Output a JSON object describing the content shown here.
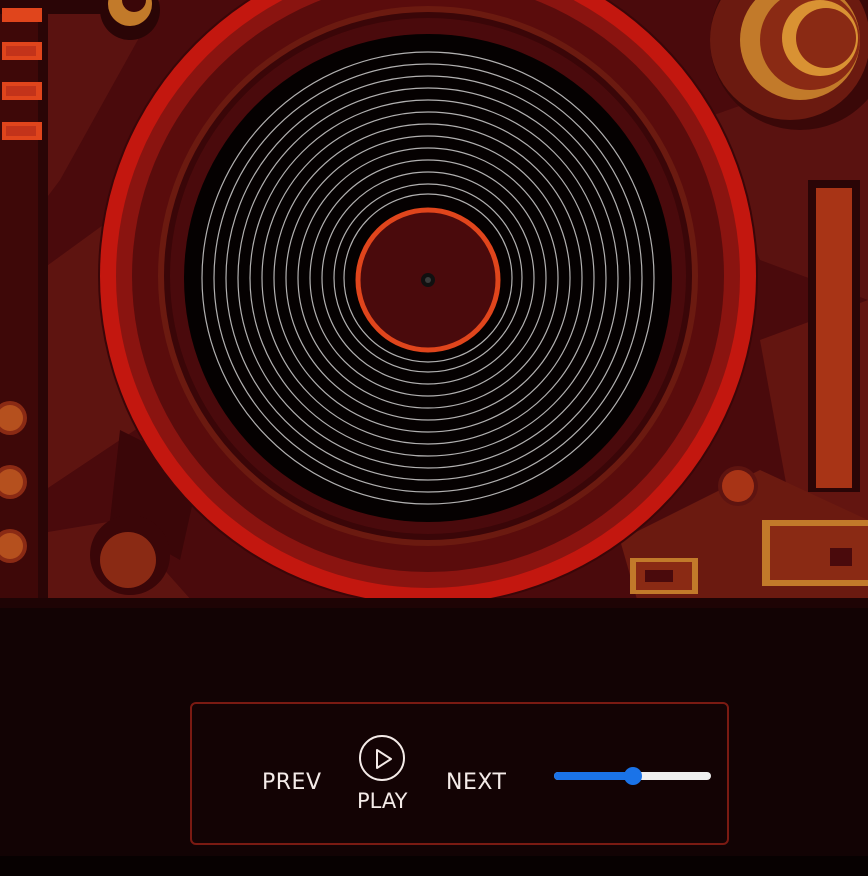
{
  "player": {
    "prev_label": "PREV",
    "play_label": "PLAY",
    "next_label": "NEXT",
    "volume_level": 0.5
  },
  "colors": {
    "accent": "#1a73e8",
    "background": "#120304",
    "panel_border": "#7a1a12",
    "record_label": "#4a0a0c",
    "record_label_ring": "#e0451c",
    "platter_ring": "#c3170f",
    "text": "#f4ebe8"
  },
  "icons": {
    "play": "play-icon",
    "record": "vinyl-record-icon"
  }
}
